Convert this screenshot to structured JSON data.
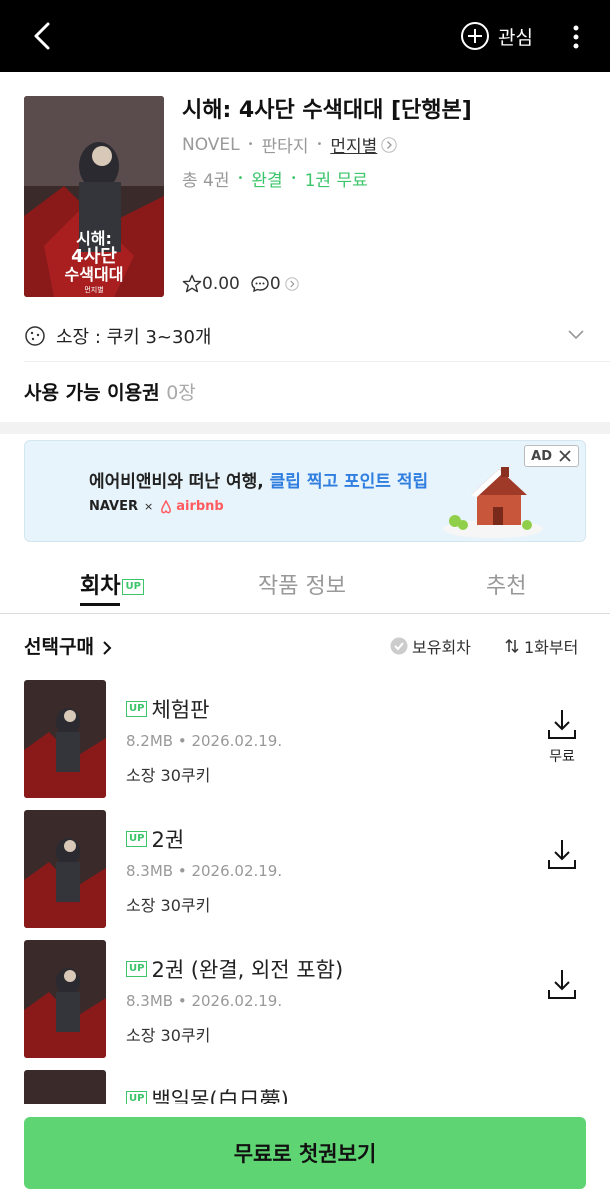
{
  "header": {
    "favorite_label": "관심"
  },
  "book": {
    "title": "시해: 4사단 수색대대 [단행본]",
    "format": "NOVEL",
    "genre": "판타지",
    "author": "먼지별",
    "volumes": "총 4권",
    "status": "완결",
    "free": "1권 무료",
    "rating": "0.00",
    "comments": "0",
    "cover_title_lines": [
      "시해:",
      "4사단",
      "수색대대"
    ],
    "cover_author": "먼지별"
  },
  "possess": {
    "text": "소장 : 쿠키 3~30개"
  },
  "ticket": {
    "label": "사용 가능 이용권",
    "count": "0장"
  },
  "ad": {
    "headline_plain": "에어비앤비와 떠난 여행,",
    "headline_highlight": "클립 찍고 포인트 적립",
    "brand1": "NAVER",
    "brand_x": "×",
    "brand2": "airbnb",
    "badge": "AD"
  },
  "tabs": [
    {
      "label": "회차",
      "badge": "UP"
    },
    {
      "label": "작품 정보"
    },
    {
      "label": "추천"
    }
  ],
  "list_header": {
    "select_buy": "선택구매",
    "owned": "보유회차",
    "sort": "1화부터"
  },
  "episodes": [
    {
      "badge": "UP",
      "title": "체험판",
      "meta": "8.2MB • 2026.02.19.",
      "price": "소장 30쿠키",
      "download_label": "무료"
    },
    {
      "badge": "UP",
      "title": "2권",
      "meta": "8.3MB • 2026.02.19.",
      "price": "소장 30쿠키"
    },
    {
      "badge": "UP",
      "title": "2권 (완결, 외전 포함)",
      "meta": "8.3MB • 2026.02.19.",
      "price": "소장 30쿠키"
    },
    {
      "badge": "UP",
      "title": "백일몽(白日夢)"
    }
  ],
  "cta": {
    "label": "무료로 첫권보기"
  },
  "colors": {
    "accent_green": "#3cc56b",
    "cta_green": "#5fd473",
    "ad_blue": "#2f7ee0"
  }
}
